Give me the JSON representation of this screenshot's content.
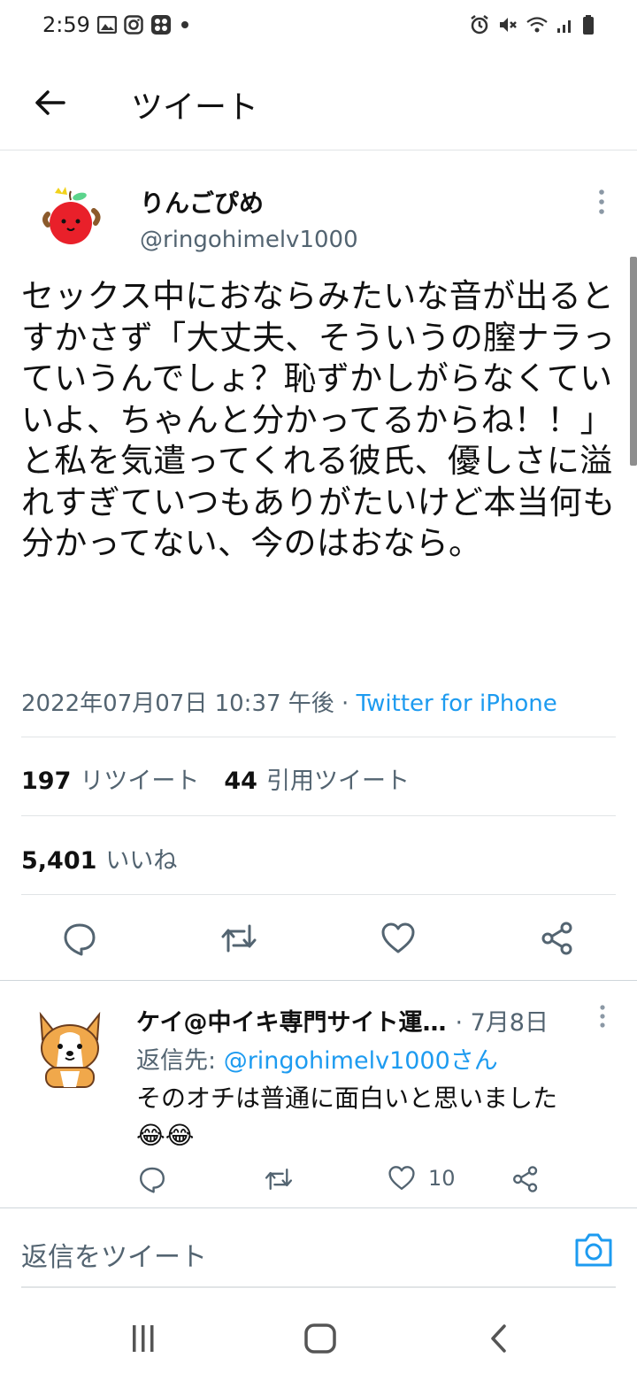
{
  "status_bar": {
    "time": "2:59",
    "left_icons": [
      "gallery-icon",
      "instagram-icon",
      "app-icon",
      "dot-icon"
    ],
    "right_icons": [
      "alarm-icon",
      "mute-icon",
      "wifi-icon",
      "signal-icon",
      "battery-icon"
    ]
  },
  "header": {
    "title": "ツイート"
  },
  "tweet": {
    "author_name": "りんごぴめ",
    "author_handle": "@ringohimelv1000",
    "text": "セックス中におならみたいな音が出るとすかさず「大丈夫、そういうの膣ナラっていうんでしょ？恥ずかしがらなくていいよ、ちゃんと分かってるからね！！」と私を気遣ってくれる彼氏、優しさに溢れすぎていつもありがたいけど本当何も分かってない、今のはおなら。",
    "timestamp": "2022年07月07日 10:37 午後",
    "separator": " · ",
    "source": "Twitter for iPhone"
  },
  "stats": {
    "retweets_count": "197",
    "retweets_label": "リツイート",
    "quotes_count": "44",
    "quotes_label": "引用ツイート",
    "likes_count": "5,401",
    "likes_label": "いいね"
  },
  "reply": {
    "author_name": "ケイ@中イキ専門サイト運…",
    "date": "· 7月8日",
    "reply_to_label": "返信先: ",
    "reply_to_mention": "@ringohimelv1000さん",
    "text": "そのオチは普通に面白いと思いました😂😂",
    "like_count": "10"
  },
  "compose": {
    "placeholder": "返信をツイート"
  },
  "colors": {
    "accent": "#1d9bf0",
    "secondary_text": "#536471",
    "divider": "#e1e4e6"
  }
}
